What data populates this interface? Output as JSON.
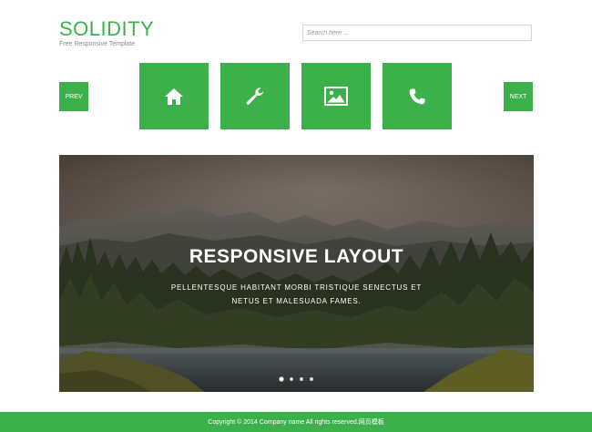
{
  "header": {
    "title": "SOLIDITY",
    "tagline": "Free Responsive Template",
    "search_placeholder": "Search here ..."
  },
  "nav": {
    "prev_label": "PREV",
    "next_label": "NEXT",
    "tiles": [
      {
        "icon": "home-icon"
      },
      {
        "icon": "wrench-icon"
      },
      {
        "icon": "image-icon"
      },
      {
        "icon": "phone-icon"
      }
    ]
  },
  "slider": {
    "heading": "RESPONSIVE LAYOUT",
    "text": "PELLENTESQUE HABITANT MORBI TRISTIQUE SENECTUS ET NETUS ET MALESUADA FAMES.",
    "active_slide": 1,
    "slide_count": 4
  },
  "footer": {
    "copyright": "Copyright © 2014 Company name All rights reserved.网页模板"
  },
  "colors": {
    "accent": "#3cb04a",
    "text_light": "#ffffff",
    "muted": "#8a8a8a"
  }
}
